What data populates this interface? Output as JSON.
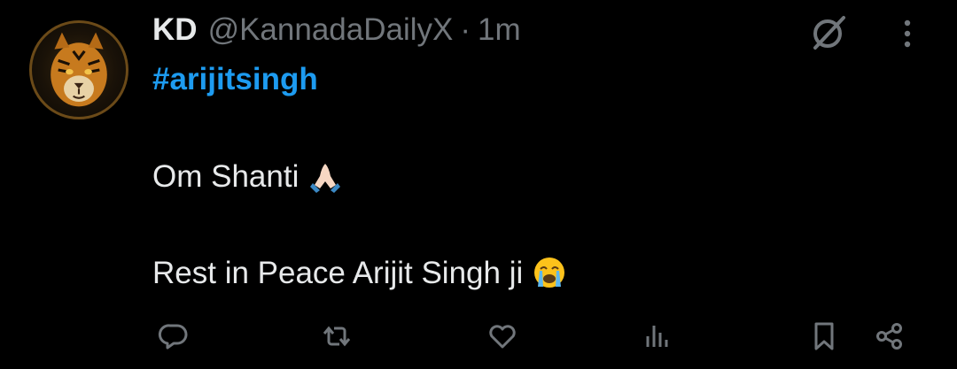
{
  "tweet": {
    "display_name": "KD",
    "handle": "@KannadaDailyX",
    "separator": "·",
    "time": "1m",
    "hashtag": "#arijitsingh",
    "line1": "Om Shanti",
    "line1_emoji": "folded-hands",
    "line2": "Rest in Peace Arijit Singh ji",
    "line2_emoji": "loudly-crying-face"
  },
  "actions": [
    "reply-icon",
    "repost-icon",
    "like-icon",
    "views-icon",
    "bookmark-icon",
    "share-icon"
  ],
  "colors": {
    "background": "#000000",
    "text": "#e7e9ea",
    "muted": "#71767b",
    "link": "#1d9bf0"
  }
}
